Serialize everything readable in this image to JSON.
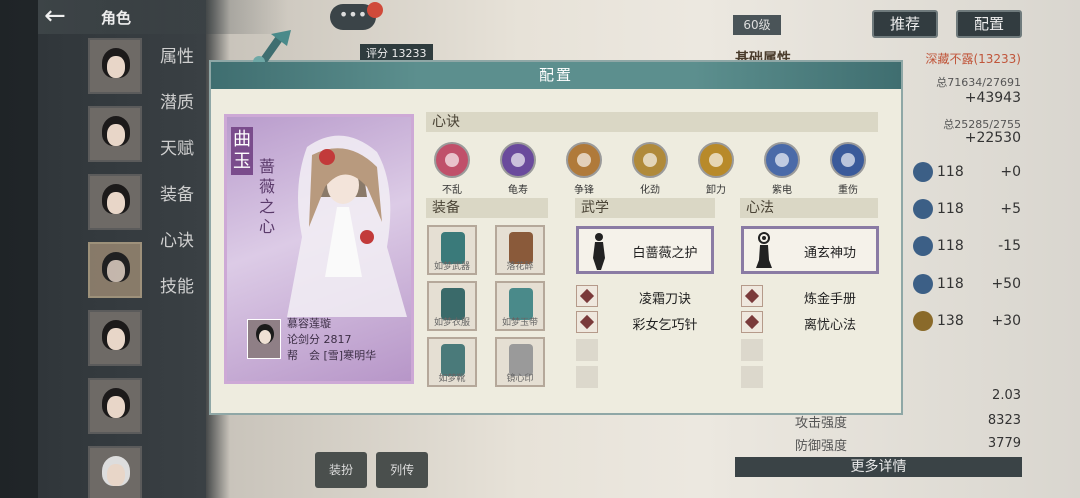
{
  "header": {
    "back_icon": "back-arrow-icon",
    "title": "角色"
  },
  "chat": {
    "icon": "chat-bubble-icon",
    "text": "•••"
  },
  "top_rating": "评分 13233",
  "level": "60级",
  "buttons": {
    "recommend": "推荐",
    "config": "配置"
  },
  "side_nav": [
    "属性",
    "潜质",
    "天赋",
    "装备",
    "心诀",
    "技能"
  ],
  "right_panel": {
    "title": "基础属性",
    "badge": "深藏不露(13233)",
    "total1": "总71634/27691",
    "big1": "+43943",
    "total2": "总25285/2755",
    "big2": "+22530",
    "stats": [
      {
        "value": "118",
        "delta": "+0"
      },
      {
        "value": "118",
        "delta": "+5"
      },
      {
        "value": "118",
        "delta": "-15"
      },
      {
        "value": "118",
        "delta": "+50"
      },
      {
        "value": "138",
        "delta": "+30"
      }
    ],
    "num1": "2.03",
    "attack_label": "攻击强度",
    "attack": "8323",
    "defense_label": "防御强度",
    "defense": "3779",
    "more": "更多详情"
  },
  "bottom_buttons": [
    "装扮",
    "列传"
  ],
  "modal": {
    "title": "配置",
    "card": {
      "name": "曲玉",
      "subtitle": "蔷薇之心",
      "owner_name": "慕容莲璇",
      "owner_score": "论剑分 2817",
      "owner_guild": "帮　会 [雪]寒明华"
    },
    "sections": {
      "xinjue": "心诀",
      "equip": "装备",
      "wuxue": "武学",
      "xinfa": "心法"
    },
    "xinjue_items": [
      {
        "label": "不乱",
        "color": "#c0506a"
      },
      {
        "label": "龟寿",
        "color": "#6a4a9c"
      },
      {
        "label": "争锋",
        "color": "#b07a3a"
      },
      {
        "label": "化劲",
        "color": "#b08a3a"
      },
      {
        "label": "卸力",
        "color": "#b88a2a"
      },
      {
        "label": "紫电",
        "color": "#4a6aa8"
      },
      {
        "label": "重伤",
        "color": "#3a5a9a"
      }
    ],
    "equipment": [
      {
        "name": "如梦武器",
        "color": "#3a7a7a"
      },
      {
        "name": "落花醉",
        "color": "#8a5a3a"
      },
      {
        "name": "如梦衣服",
        "color": "#3a6a6a"
      },
      {
        "name": "如梦玉带",
        "color": "#4a8a8a"
      },
      {
        "name": "如梦靴",
        "color": "#4a7a7a"
      },
      {
        "name": "镜心印",
        "color": "#9a9a9a"
      }
    ],
    "wuxue": {
      "main": "白蔷薇之护",
      "rows": [
        "凌霜刀诀",
        "彩女乞巧针"
      ]
    },
    "xinfa": {
      "main": "通玄神功",
      "rows": [
        "炼金手册",
        "离忧心法"
      ]
    }
  }
}
